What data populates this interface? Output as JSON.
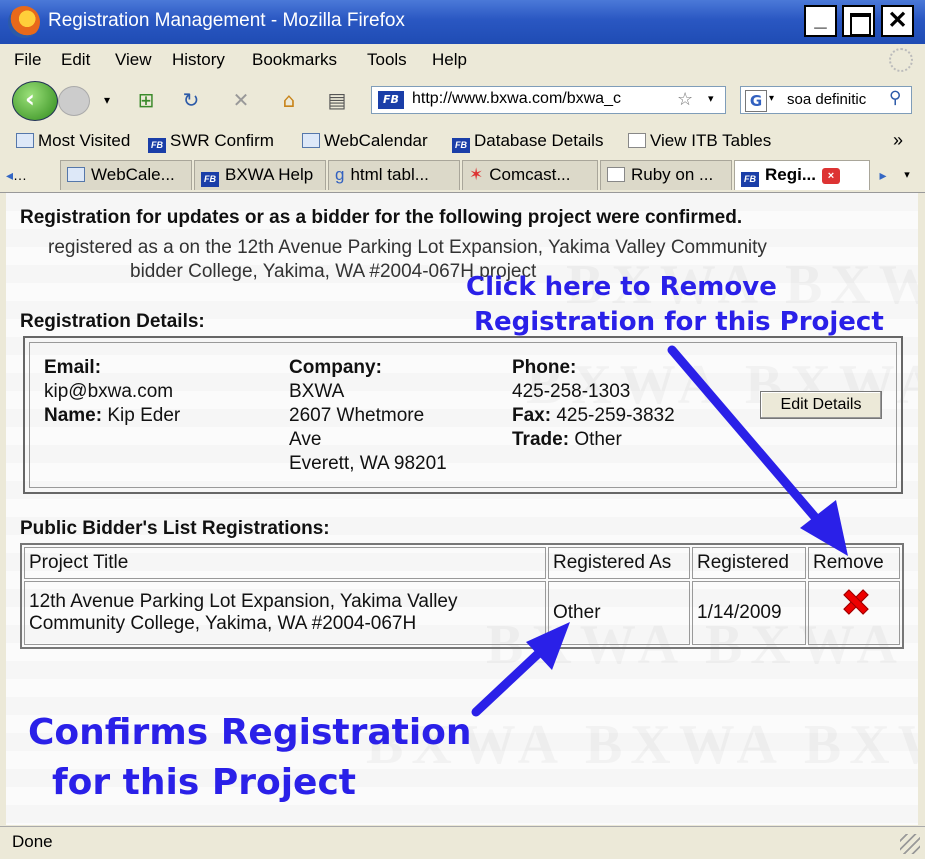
{
  "window": {
    "title": "Registration Management - Mozilla Firefox"
  },
  "menu": [
    "File",
    "Edit",
    "View",
    "History",
    "Bookmarks",
    "Tools",
    "Help"
  ],
  "url": "http://www.bxwa.com/bxwa_c",
  "search": {
    "engine": "G",
    "value": "soa definitic"
  },
  "bookmarks": [
    "Most Visited",
    "SWR Confirm",
    "WebCalendar",
    "Database Details",
    "View ITB Tables"
  ],
  "bookmarks_more": "»",
  "tabs": [
    "…",
    "WebCale...",
    "BXWA Help",
    "html tabl...",
    "Comcast...",
    "Ruby on ...",
    "Regi..."
  ],
  "tab_close": "×",
  "page": {
    "heading": "Registration for updates or as a bidder for the following project were confirmed.",
    "sub_line1": "registered as a  on the 12th Avenue Parking Lot Expansion, Yakima Valley Community",
    "sub_line2": "bidder  College, Yakima, WA #2004-067H project",
    "details_label": "Registration Details:",
    "email_label": "Email:",
    "email": "kip@bxwa.com",
    "name_label": "Name:",
    "name": "Kip Eder",
    "company_label": "Company:",
    "company": "BXWA",
    "address1": "2607 Whetmore",
    "address2": "Ave",
    "address3": "Everett, WA 98201",
    "phone_label": "Phone:",
    "phone": "425-258-1303",
    "fax_label": "Fax:",
    "fax": "425-259-3832",
    "trade_label": "Trade:",
    "trade": "Other",
    "edit_button": "Edit Details",
    "list_label": "Public Bidder's List Registrations:",
    "table": {
      "headers": [
        "Project Title",
        "Registered As",
        "Registered",
        "Remove"
      ],
      "rows": [
        {
          "title_line1": "12th Avenue Parking Lot Expansion, Yakima Valley",
          "title_line2": "Community College, Yakima, WA #2004-067H",
          "registered_as": "Other",
          "registered": "1/14/2009"
        }
      ]
    }
  },
  "annotations": {
    "remove_line1": "Click here to Remove",
    "remove_line2": "Registration  for this Project",
    "confirm_line1": "Confirms Registration",
    "confirm_line2": "for this Project",
    "color": "#2a20e8"
  },
  "status": "Done",
  "colors": {
    "titlebar": "#2a57c2",
    "chrome": "#ece9d8",
    "remove_icon": "#e00000"
  }
}
